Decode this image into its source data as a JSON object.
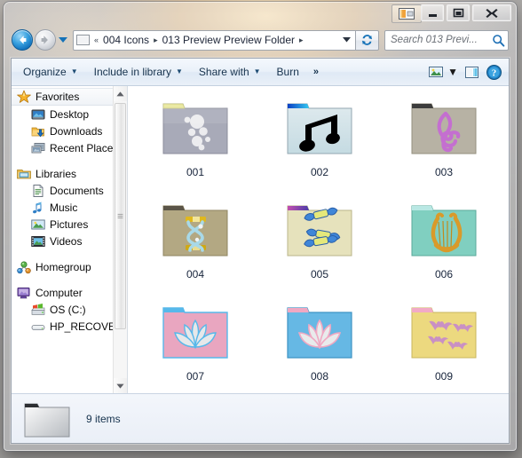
{
  "window": {
    "caption_buttons": {
      "preview_pane_toggle": "Show the preview pane",
      "minimize": "Minimize",
      "maximize": "Maximize",
      "close": "Close"
    }
  },
  "address_bar": {
    "back_label": "Back",
    "forward_label": "Forward",
    "recent_pages_label": "Recent pages",
    "folder_icon": "folder-icon",
    "overflow_chevron": "«",
    "crumbs": [
      {
        "label": "004 Icons",
        "sep": "▸"
      },
      {
        "label": "013 Preview Preview Folder",
        "sep": "▸"
      }
    ],
    "dropdown_caret": "▼",
    "refresh_label": "Refresh",
    "search": {
      "placeholder": "Search 013 Previ...",
      "icon": "search-icon"
    }
  },
  "command_bar": {
    "items": [
      {
        "label": "Organize",
        "caret": "▼"
      },
      {
        "label": "Include in library",
        "caret": "▼"
      },
      {
        "label": "Share with",
        "caret": "▼"
      },
      {
        "label": "Burn",
        "caret": ""
      }
    ],
    "overflow": "»",
    "view_caret": "▼",
    "view_icon": "change-your-view-icon",
    "preview_icon": "show-preview-pane-icon",
    "help_icon": "help-icon"
  },
  "navigation_pane": {
    "groups": [
      {
        "root": {
          "label": "Favorites",
          "icon": "star-icon",
          "selected": true
        },
        "children": [
          {
            "label": "Desktop",
            "icon": "desktop-icon"
          },
          {
            "label": "Downloads",
            "icon": "downloads-icon"
          },
          {
            "label": "Recent Place",
            "icon": "recent-places-icon"
          }
        ]
      },
      {
        "root": {
          "label": "Libraries",
          "icon": "libraries-icon",
          "selected": false
        },
        "children": [
          {
            "label": "Documents",
            "icon": "documents-icon"
          },
          {
            "label": "Music",
            "icon": "music-icon"
          },
          {
            "label": "Pictures",
            "icon": "pictures-icon"
          },
          {
            "label": "Videos",
            "icon": "videos-icon"
          }
        ]
      },
      {
        "root": {
          "label": "Homegroup",
          "icon": "homegroup-icon",
          "selected": false
        },
        "children": []
      },
      {
        "root": {
          "label": "Computer",
          "icon": "computer-icon",
          "selected": false
        },
        "children": [
          {
            "label": "OS (C:)",
            "icon": "windows-drive-icon"
          },
          {
            "label": "HP_RECOVER",
            "icon": "drive-icon"
          }
        ]
      }
    ],
    "scrollbar": {
      "up": "▲",
      "down": "▼"
    }
  },
  "file_list": {
    "items": [
      {
        "name": "001",
        "icon": "folder-bubbles-icon",
        "body": "#a8aab8",
        "tab": "#e8e79a",
        "art": "#f2f2f4"
      },
      {
        "name": "002",
        "icon": "folder-music-note-icon",
        "body": "#cfe0e6",
        "tab": "#1668d8",
        "art": "#000000"
      },
      {
        "name": "003",
        "icon": "folder-treble-clef-icon",
        "body": "#b7b2a4",
        "tab": "#3c3c3c",
        "art": "#c46fd0"
      },
      {
        "name": "004",
        "icon": "folder-hourglass-icon",
        "body": "#b3a883",
        "tab": "#5b5548",
        "art": "#e0b81d"
      },
      {
        "name": "005",
        "icon": "folder-dna-icon",
        "body": "#e6e2bc",
        "tab": "#c44fb0",
        "art": "#3f86d8"
      },
      {
        "name": "006",
        "icon": "folder-lyre-icon",
        "body": "#80cfc0",
        "tab": "#b9e8e4",
        "art": "#d99a2a"
      },
      {
        "name": "007",
        "icon": "folder-lotus-pink-icon",
        "body": "#e9a6c0",
        "tab": "#57b8ea",
        "art": "#e6e8ea"
      },
      {
        "name": "008",
        "icon": "folder-lotus-blue-icon",
        "body": "#66b8e4",
        "tab": "#f0a8c2",
        "art": "#e9ebec"
      },
      {
        "name": "009",
        "icon": "folder-bats-icon",
        "body": "#ecd97f",
        "tab": "#f2aac6",
        "art": "#c990c4"
      }
    ]
  },
  "status_bar": {
    "item_count": "9 items",
    "icon": "folder-generic-icon"
  }
}
